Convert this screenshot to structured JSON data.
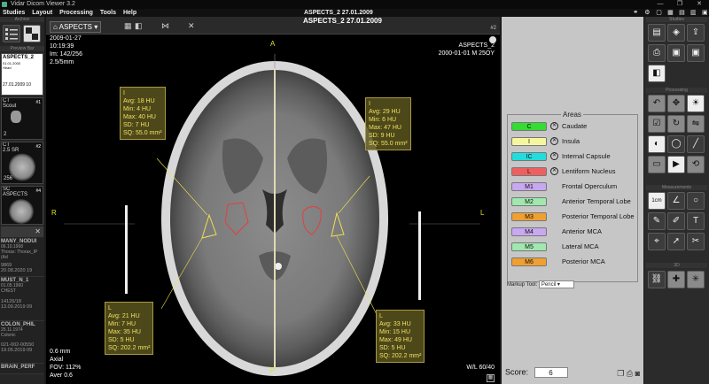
{
  "window": {
    "title": "Vidar Dicom Viewer 3.2",
    "controls": [
      "—",
      "❐",
      "✕"
    ]
  },
  "menu": {
    "items": [
      "Studies",
      "Layout",
      "Processing",
      "Tools",
      "Help"
    ],
    "title": "ASPECTS_2  27.01.2009"
  },
  "left": {
    "archive_label": "Archive",
    "preview_label": "Preview Bar",
    "study_card": {
      "name": "ASPECTS_2",
      "line1": "01.01.2000",
      "line2": "Head",
      "date": "27.01.2009 10"
    },
    "series": [
      {
        "modality": "CT",
        "desc": "Scout",
        "num": "#1",
        "count": "2"
      },
      {
        "modality": "CT",
        "desc": "2.5 SR",
        "num": "#2",
        "count": "256"
      },
      {
        "modality": "SC",
        "desc": "ASPECTS",
        "num": "#4",
        "count": ""
      }
    ],
    "studies": [
      {
        "name": "MANY_NODUI",
        "l1": "06.10.1968",
        "l2": "Thorax: Thorax_IP (Ad",
        "l3": "9869",
        "l4": "20.08.2020 19"
      },
      {
        "name": "MUST_N_1",
        "l1": "01.05.1960",
        "l2": "CHEST",
        "l3": "14126/18",
        "l4": "13.09.2019 09"
      },
      {
        "name": "COLON_PHIL",
        "l1": "25.11.1974",
        "l2": "Colonic",
        "l3": "021-002-00550",
        "l4": "19.05.2019 09"
      },
      {
        "name": "BRAIN_PERF",
        "l1": "",
        "l2": "",
        "l3": "",
        "l4": ""
      }
    ]
  },
  "viewer": {
    "series_select": "ASPECTS",
    "title": "ASPECTS_2  27.01.2009",
    "viewport_num": "#2",
    "top_left": [
      "2009-01-27",
      "10:19:39",
      "Im: 142/256",
      "2.5/5mm"
    ],
    "top_right": [
      "ASPECTS_2",
      "2000-01-01 M   25OY"
    ],
    "bottom_left": [
      "0.6 mm",
      "Axial",
      "FOV: 112%",
      "Aver 0.6"
    ],
    "bottom_right": "W/L 60/40",
    "orient": {
      "top": "A",
      "bottom": "P",
      "left": "R",
      "right": "L"
    },
    "stats": [
      {
        "id": "tl",
        "lines": [
          "I",
          "Avg: 18 HU",
          "Min: 4 HU",
          "Max: 40 HU",
          "SD: 7 HU",
          "SQ: 55.0 mm²"
        ]
      },
      {
        "id": "tr",
        "lines": [
          "I",
          "Avg: 29 HU",
          "Min: 6 HU",
          "Max: 47 HU",
          "SD: 9 HU",
          "SQ: 55.0 mm²"
        ]
      },
      {
        "id": "bl",
        "lines": [
          "L",
          "Avg: 21 HU",
          "Min: 7 HU",
          "Max: 35 HU",
          "SD: 5 HU",
          "SQ: 202.2 mm²"
        ]
      },
      {
        "id": "br",
        "lines": [
          "L",
          "Avg: 33 HU",
          "Min: 15 HU",
          "Max: 49 HU",
          "SD: 5 HU",
          "SQ: 202.2 mm²"
        ]
      }
    ]
  },
  "areas": {
    "title": "Areas",
    "rows": [
      {
        "code": "C",
        "label": "Caudate",
        "color": "#33dd33",
        "x": true
      },
      {
        "code": "I",
        "label": "Insula",
        "color": "#f6f6a0",
        "x": true
      },
      {
        "code": "IC",
        "label": "Internal Capsule",
        "color": "#22dddd",
        "x": true
      },
      {
        "code": "L",
        "label": "Lentiform Nucleus",
        "color": "#ee6060",
        "x": true
      },
      {
        "code": "M1",
        "label": "Frontal Operculum",
        "color": "#c8a8f0",
        "x": false
      },
      {
        "code": "M2",
        "label": "Anterior Temporal Lobe",
        "color": "#a0e8b0",
        "x": false
      },
      {
        "code": "M3",
        "label": "Posterior Temporal Lobe",
        "color": "#f0a030",
        "x": false
      },
      {
        "code": "M4",
        "label": "Anterior MCA",
        "color": "#c8a8f0",
        "x": false
      },
      {
        "code": "M5",
        "label": "Lateral MCA",
        "color": "#a0e8b0",
        "x": false
      },
      {
        "code": "M6",
        "label": "Posterior MCA",
        "color": "#f0a030",
        "x": false
      }
    ],
    "markup_label": "Markup Tool:",
    "markup_value": "Pencil",
    "score_label": "Score:",
    "score_value": "6"
  },
  "tools": {
    "studies_label": "Studies",
    "processing_label": "Processing",
    "measure_label": "Measurements",
    "three_d_label": "3D"
  }
}
